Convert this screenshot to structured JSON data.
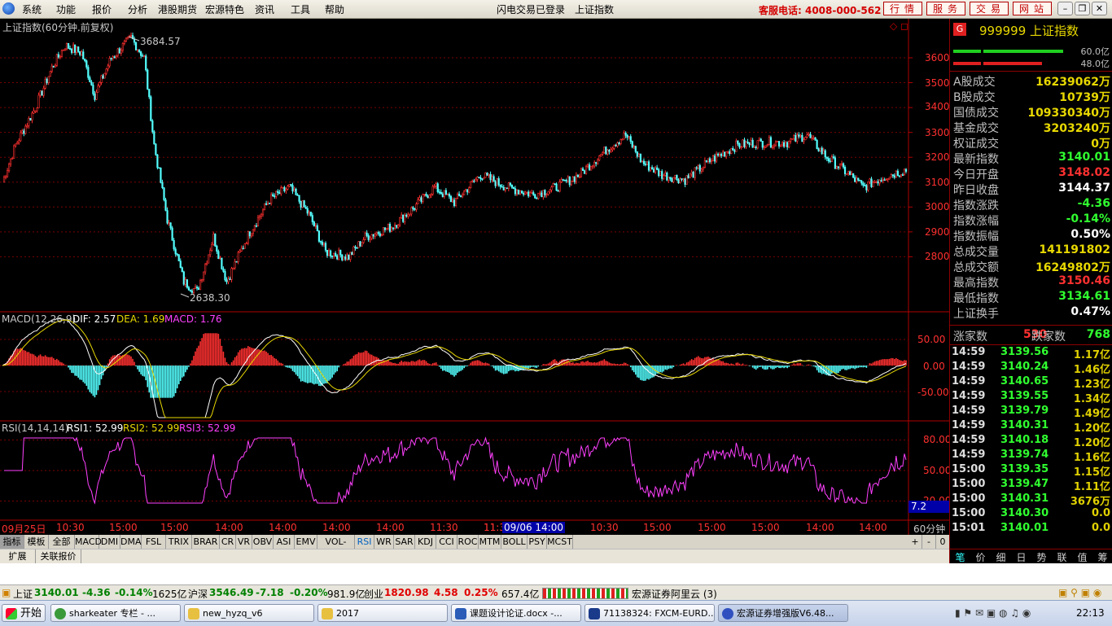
{
  "menu": {
    "items": [
      "系统",
      "功能",
      "报价",
      "分析",
      "港股期货",
      "宏源特色",
      "资讯",
      "工具",
      "帮助"
    ],
    "center": [
      "闪电交易已登录",
      "上证指数"
    ],
    "hotline": "客服电话: 4008-000-562",
    "buttons": [
      "行情",
      "服务",
      "交易",
      "网站"
    ],
    "window_icons": [
      "–",
      "❐",
      "✕"
    ]
  },
  "chart": {
    "title": "上证指数(60分钟.前复权)",
    "high_label": "3684.57",
    "low_label": "2638.30",
    "price_axis": [
      "3600",
      "3500",
      "3400",
      "3300",
      "3200",
      "3100",
      "3000",
      "2900",
      "2800"
    ],
    "macd_header": {
      "name": "MACD(12,26,9)",
      "dif": "DIF: 2.57",
      "dea": "DEA: 1.69",
      "macd": "MACD: 1.76"
    },
    "macd_axis": [
      "50.00",
      "0.00",
      "-50.00"
    ],
    "rsi_header": {
      "name": "RSI(14,14,14)",
      "rsi1": "RSI1: 52.99",
      "rsi2": "RSI2: 52.99",
      "rsi3": "RSI3: 52.99"
    },
    "rsi_axis": [
      "80.00",
      "50.00",
      "20.00"
    ],
    "rsi_box": "7.2",
    "time_labels": [
      "09月25日",
      "10:30",
      "15:00",
      "15:00",
      "14:00",
      "14:00",
      "14:00",
      "14:00",
      "11:30",
      "11:30",
      "11:3",
      "10:30",
      "15:00",
      "15:00",
      "15:00",
      "14:00",
      "14:00"
    ],
    "cursor_time": "09/06 14:00",
    "period_label": "60分钟"
  },
  "colors": {
    "up": "#ff3030",
    "down": "#54ffff",
    "grid": "#7a0000",
    "yellow": "#e8d800",
    "magenta": "#ff40ff"
  },
  "tabs": [
    "指标",
    "模板",
    "全部",
    "MACD",
    "DMI",
    "DMA",
    "FSL",
    "TRIX",
    "BRAR",
    "CR",
    "VR",
    "OBV",
    "ASI",
    "EMV",
    "VOL-TDX",
    "RSI",
    "WR",
    "SAR",
    "KDJ",
    "CCI",
    "ROC",
    "MTM",
    "BOLL",
    "PSY",
    "MCST"
  ],
  "tab_controls": [
    "+",
    "-",
    "0"
  ],
  "tabs2": [
    "扩展",
    "关联报价"
  ],
  "panel": {
    "badge": "G",
    "code_name": "999999 上证指数",
    "bar1_label": "60.0亿",
    "bar2_label": "48.0亿",
    "rows": [
      {
        "label": "A股成交",
        "value": "16239062万",
        "color": "#e8d800"
      },
      {
        "label": "B股成交",
        "value": "10739万",
        "color": "#e8d800"
      },
      {
        "label": "国债成交",
        "value": "109330340万",
        "color": "#e8d800"
      },
      {
        "label": "基金成交",
        "value": "3203240万",
        "color": "#e8d800"
      },
      {
        "label": "权证成交",
        "value": "0万",
        "color": "#e8d800"
      },
      {
        "label": "最新指数",
        "value": "3140.01",
        "color": "#30ff30"
      },
      {
        "label": "今日开盘",
        "value": "3148.02",
        "color": "#ff3030"
      },
      {
        "label": "昨日收盘",
        "value": "3144.37",
        "color": "#ffffff"
      },
      {
        "label": "指数涨跌",
        "value": "-4.36",
        "color": "#30ff30"
      },
      {
        "label": "指数涨幅",
        "value": "-0.14%",
        "color": "#30ff30"
      },
      {
        "label": "指数振幅",
        "value": "0.50%",
        "color": "#ffffff"
      },
      {
        "label": "总成交量",
        "value": "141191802",
        "color": "#e8d800"
      },
      {
        "label": "总成交额",
        "value": "16249802万",
        "color": "#e8d800"
      },
      {
        "label": "最高指数",
        "value": "3150.46",
        "color": "#ff3030"
      },
      {
        "label": "最低指数",
        "value": "3134.61",
        "color": "#30ff30"
      },
      {
        "label": "上证换手",
        "value": "0.47%",
        "color": "#ffffff"
      }
    ],
    "up_label": "涨家数",
    "up_count": "530",
    "down_label": "跌家数",
    "down_count": "768",
    "ticks": [
      {
        "time": "14:59",
        "price": "3139.56",
        "vol": "1.17亿"
      },
      {
        "time": "14:59",
        "price": "3140.24",
        "vol": "1.46亿"
      },
      {
        "time": "14:59",
        "price": "3140.65",
        "vol": "1.23亿"
      },
      {
        "time": "14:59",
        "price": "3139.55",
        "vol": "1.34亿"
      },
      {
        "time": "14:59",
        "price": "3139.79",
        "vol": "1.49亿"
      },
      {
        "time": "14:59",
        "price": "3140.31",
        "vol": "1.20亿"
      },
      {
        "time": "14:59",
        "price": "3140.18",
        "vol": "1.20亿"
      },
      {
        "time": "14:59",
        "price": "3139.74",
        "vol": "1.16亿"
      },
      {
        "time": "15:00",
        "price": "3139.35",
        "vol": "1.15亿"
      },
      {
        "time": "15:00",
        "price": "3139.47",
        "vol": "1.11亿"
      },
      {
        "time": "15:00",
        "price": "3140.31",
        "vol": "3676万"
      },
      {
        "time": "15:00",
        "price": "3140.30",
        "vol": "0.0"
      },
      {
        "time": "15:01",
        "price": "3140.01",
        "vol": "0.0"
      }
    ],
    "bottom_tabs": [
      "笔",
      "价",
      "细",
      "日",
      "势",
      "联",
      "值",
      "筹"
    ]
  },
  "status": {
    "sh_label": "上证",
    "sh_val": "3140.01",
    "sh_chg": "-4.36",
    "sh_pct": "-0.14%",
    "sh_amt": "1625亿",
    "hs_label": "沪深",
    "hs_val": "3546.49",
    "hs_chg": "-7.18",
    "hs_pct": "-0.20%",
    "hs_amt": "981.9亿",
    "cy_label": "创业",
    "cy_val": "1820.98",
    "cy_chg": "4.58",
    "cy_pct": "0.25%",
    "cy_amt": "657.4亿",
    "broker": "宏源证券阿里云 (3)"
  },
  "taskbar": {
    "start": "开始",
    "items": [
      "sharkeater 专栏 - ...",
      "new_hyzq_v6",
      "2017",
      "课题设计论证.docx -...",
      "71138324: FXCM-EURD...",
      "宏源证券增强版V6.48..."
    ],
    "clock": "22:13"
  }
}
